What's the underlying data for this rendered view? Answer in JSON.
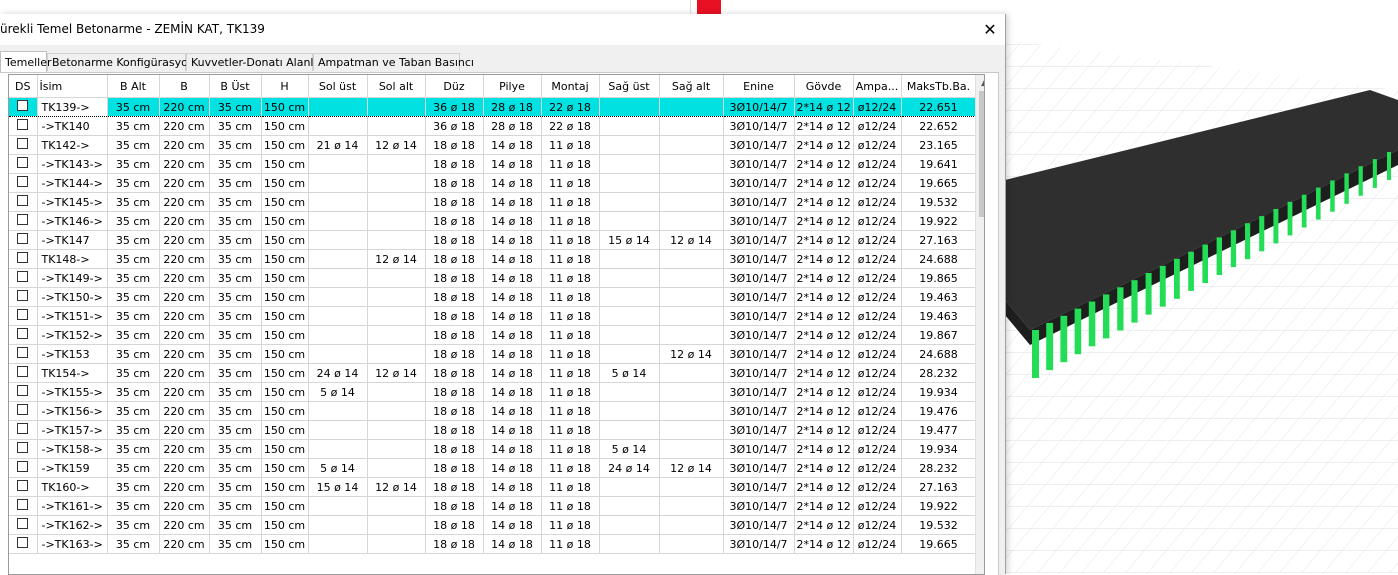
{
  "dialog": {
    "title": "ürekli Temel Betonarme - ZEMİN KAT, TK139",
    "close_glyph": "✕"
  },
  "tabs": [
    {
      "label": "Temeller",
      "active": true
    },
    {
      "label": "Betonarme Konfigürasyonu",
      "active": false
    },
    {
      "label": "Kuvvetler-Donatı Alanları",
      "active": false
    },
    {
      "label": "Ampatman ve Taban Basıncı",
      "active": false
    }
  ],
  "table": {
    "columns": [
      "DS",
      "İsim",
      "B Alt",
      "B",
      "B Üst",
      "H",
      "Sol üst",
      "Sol alt",
      "Düz",
      "Pilye",
      "Montaj",
      "Sağ üst",
      "Sağ alt",
      "Enine",
      "Gövde",
      "Ampa...",
      "MaksTb.Ba."
    ],
    "selected_row": 0,
    "rows": [
      [
        "",
        "TK139->",
        "35 cm",
        "220 cm",
        "35 cm",
        "150 cm",
        "",
        "",
        "36 ø 18",
        "28 ø 18",
        "22 ø 18",
        "",
        "",
        "3Ø10/14/7",
        "2*14 ø 12",
        "ø12/24",
        "22.651"
      ],
      [
        "",
        "->TK140",
        "35 cm",
        "220 cm",
        "35 cm",
        "150 cm",
        "",
        "",
        "36 ø 18",
        "28 ø 18",
        "22 ø 18",
        "",
        "",
        "3Ø10/14/7",
        "2*14 ø 12",
        "ø12/24",
        "22.652"
      ],
      [
        "",
        "TK142->",
        "35 cm",
        "220 cm",
        "35 cm",
        "150 cm",
        "21 ø 14",
        "12 ø 14",
        "18 ø 18",
        "14 ø 18",
        "11 ø 18",
        "",
        "",
        "3Ø10/14/7",
        "2*14 ø 12",
        "ø12/24",
        "23.165"
      ],
      [
        "",
        "->TK143->",
        "35 cm",
        "220 cm",
        "35 cm",
        "150 cm",
        "",
        "",
        "18 ø 18",
        "14 ø 18",
        "11 ø 18",
        "",
        "",
        "3Ø10/14/7",
        "2*14 ø 12",
        "ø12/24",
        "19.641"
      ],
      [
        "",
        "->TK144->",
        "35 cm",
        "220 cm",
        "35 cm",
        "150 cm",
        "",
        "",
        "18 ø 18",
        "14 ø 18",
        "11 ø 18",
        "",
        "",
        "3Ø10/14/7",
        "2*14 ø 12",
        "ø12/24",
        "19.665"
      ],
      [
        "",
        "->TK145->",
        "35 cm",
        "220 cm",
        "35 cm",
        "150 cm",
        "",
        "",
        "18 ø 18",
        "14 ø 18",
        "11 ø 18",
        "",
        "",
        "3Ø10/14/7",
        "2*14 ø 12",
        "ø12/24",
        "19.532"
      ],
      [
        "",
        "->TK146->",
        "35 cm",
        "220 cm",
        "35 cm",
        "150 cm",
        "",
        "",
        "18 ø 18",
        "14 ø 18",
        "11 ø 18",
        "",
        "",
        "3Ø10/14/7",
        "2*14 ø 12",
        "ø12/24",
        "19.922"
      ],
      [
        "",
        "->TK147",
        "35 cm",
        "220 cm",
        "35 cm",
        "150 cm",
        "",
        "",
        "18 ø 18",
        "14 ø 18",
        "11 ø 18",
        "15 ø 14",
        "12 ø 14",
        "3Ø10/14/7",
        "2*14 ø 12",
        "ø12/24",
        "27.163"
      ],
      [
        "",
        "TK148->",
        "35 cm",
        "220 cm",
        "35 cm",
        "150 cm",
        "",
        "12 ø 14",
        "18 ø 18",
        "14 ø 18",
        "11 ø 18",
        "",
        "",
        "3Ø10/14/7",
        "2*14 ø 12",
        "ø12/24",
        "24.688"
      ],
      [
        "",
        "->TK149->",
        "35 cm",
        "220 cm",
        "35 cm",
        "150 cm",
        "",
        "",
        "18 ø 18",
        "14 ø 18",
        "11 ø 18",
        "",
        "",
        "3Ø10/14/7",
        "2*14 ø 12",
        "ø12/24",
        "19.865"
      ],
      [
        "",
        "->TK150->",
        "35 cm",
        "220 cm",
        "35 cm",
        "150 cm",
        "",
        "",
        "18 ø 18",
        "14 ø 18",
        "11 ø 18",
        "",
        "",
        "3Ø10/14/7",
        "2*14 ø 12",
        "ø12/24",
        "19.463"
      ],
      [
        "",
        "->TK151->",
        "35 cm",
        "220 cm",
        "35 cm",
        "150 cm",
        "",
        "",
        "18 ø 18",
        "14 ø 18",
        "11 ø 18",
        "",
        "",
        "3Ø10/14/7",
        "2*14 ø 12",
        "ø12/24",
        "19.463"
      ],
      [
        "",
        "->TK152->",
        "35 cm",
        "220 cm",
        "35 cm",
        "150 cm",
        "",
        "",
        "18 ø 18",
        "14 ø 18",
        "11 ø 18",
        "",
        "",
        "3Ø10/14/7",
        "2*14 ø 12",
        "ø12/24",
        "19.867"
      ],
      [
        "",
        "->TK153",
        "35 cm",
        "220 cm",
        "35 cm",
        "150 cm",
        "",
        "",
        "18 ø 18",
        "14 ø 18",
        "11 ø 18",
        "",
        "12 ø 14",
        "3Ø10/14/7",
        "2*14 ø 12",
        "ø12/24",
        "24.688"
      ],
      [
        "",
        "TK154->",
        "35 cm",
        "220 cm",
        "35 cm",
        "150 cm",
        "24 ø 14",
        "12 ø 14",
        "18 ø 18",
        "14 ø 18",
        "11 ø 18",
        "5 ø 14",
        "",
        "3Ø10/14/7",
        "2*14 ø 12",
        "ø12/24",
        "28.232"
      ],
      [
        "",
        "->TK155->",
        "35 cm",
        "220 cm",
        "35 cm",
        "150 cm",
        "5 ø 14",
        "",
        "18 ø 18",
        "14 ø 18",
        "11 ø 18",
        "",
        "",
        "3Ø10/14/7",
        "2*14 ø 12",
        "ø12/24",
        "19.934"
      ],
      [
        "",
        "->TK156->",
        "35 cm",
        "220 cm",
        "35 cm",
        "150 cm",
        "",
        "",
        "18 ø 18",
        "14 ø 18",
        "11 ø 18",
        "",
        "",
        "3Ø10/14/7",
        "2*14 ø 12",
        "ø12/24",
        "19.476"
      ],
      [
        "",
        "->TK157->",
        "35 cm",
        "220 cm",
        "35 cm",
        "150 cm",
        "",
        "",
        "18 ø 18",
        "14 ø 18",
        "11 ø 18",
        "",
        "",
        "3Ø10/14/7",
        "2*14 ø 12",
        "ø12/24",
        "19.477"
      ],
      [
        "",
        "->TK158->",
        "35 cm",
        "220 cm",
        "35 cm",
        "150 cm",
        "",
        "",
        "18 ø 18",
        "14 ø 18",
        "11 ø 18",
        "5 ø 14",
        "",
        "3Ø10/14/7",
        "2*14 ø 12",
        "ø12/24",
        "19.934"
      ],
      [
        "",
        "->TK159",
        "35 cm",
        "220 cm",
        "35 cm",
        "150 cm",
        "5 ø 14",
        "",
        "18 ø 18",
        "14 ø 18",
        "11 ø 18",
        "24 ø 14",
        "12 ø 14",
        "3Ø10/14/7",
        "2*14 ø 12",
        "ø12/24",
        "28.232"
      ],
      [
        "",
        "TK160->",
        "35 cm",
        "220 cm",
        "35 cm",
        "150 cm",
        "15 ø 14",
        "12 ø 14",
        "18 ø 18",
        "14 ø 18",
        "11 ø 18",
        "",
        "",
        "3Ø10/14/7",
        "2*14 ø 12",
        "ø12/24",
        "27.163"
      ],
      [
        "",
        "->TK161->",
        "35 cm",
        "220 cm",
        "35 cm",
        "150 cm",
        "",
        "",
        "18 ø 18",
        "14 ø 18",
        "11 ø 18",
        "",
        "",
        "3Ø10/14/7",
        "2*14 ø 12",
        "ø12/24",
        "19.922"
      ],
      [
        "",
        "->TK162->",
        "35 cm",
        "220 cm",
        "35 cm",
        "150 cm",
        "",
        "",
        "18 ø 18",
        "14 ø 18",
        "11 ø 18",
        "",
        "",
        "3Ø10/14/7",
        "2*14 ø 12",
        "ø12/24",
        "19.532"
      ],
      [
        "",
        "->TK163->",
        "35 cm",
        "220 cm",
        "35 cm",
        "150 cm",
        "",
        "",
        "18 ø 18",
        "14 ø 18",
        "11 ø 18",
        "",
        "",
        "3Ø10/14/7",
        "2*14 ø 12",
        "ø12/24",
        "19.665"
      ]
    ]
  },
  "colors": {
    "selected_row": "#00e1e1",
    "model_slab": "#2f2f2f",
    "model_columns": "#22dd55",
    "marker": "#e81123"
  },
  "icons": {
    "close": "close-icon",
    "scroll_up": "chevron-up-icon"
  }
}
